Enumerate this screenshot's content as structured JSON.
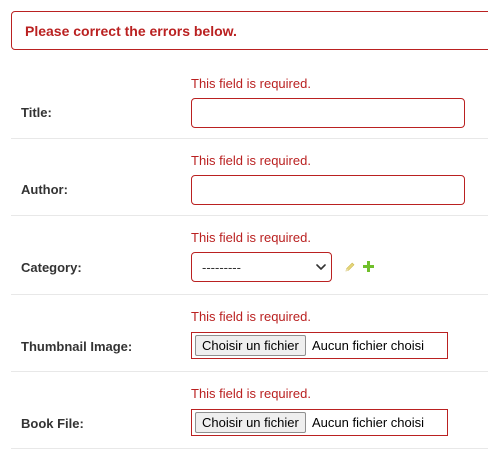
{
  "error_note": "Please correct the errors below.",
  "fields": {
    "title": {
      "error": "This field is required.",
      "label": "Title:",
      "value": ""
    },
    "author": {
      "error": "This field is required.",
      "label": "Author:",
      "value": ""
    },
    "category": {
      "error": "This field is required.",
      "label": "Category:",
      "selected": "---------",
      "icons": [
        "pencil-icon",
        "plus-icon"
      ]
    },
    "thumbnail": {
      "error": "This field is required.",
      "label": "Thumbnail Image:",
      "button_label": "Choisir un fichier",
      "status": "Aucun fichier choisi"
    },
    "book_file": {
      "error": "This field is required.",
      "label": "Book File:",
      "button_label": "Choisir un fichier",
      "status": "Aucun fichier choisi"
    }
  },
  "colors": {
    "error": "#ba2121",
    "text": "#333333",
    "edit_icon": "#e6d67a",
    "add_icon": "#70bf2b"
  }
}
